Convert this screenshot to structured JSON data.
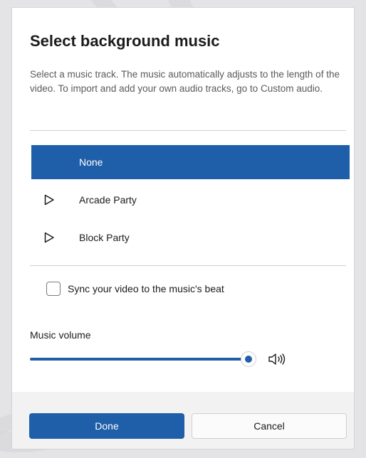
{
  "dialog": {
    "title": "Select background music",
    "description": "Select a music track. The music automatically adjusts to the length of the video. To import and add your own audio tracks, go to Custom audio."
  },
  "tracks": [
    {
      "label": "None",
      "selected": true,
      "has_play_icon": false
    },
    {
      "label": "Arcade Party",
      "selected": false,
      "has_play_icon": true,
      "icon": "play-outline-icon"
    },
    {
      "label": "Block Party",
      "selected": false,
      "has_play_icon": true,
      "icon": "play-outline-icon"
    }
  ],
  "sync": {
    "label": "Sync your video to the music's beat",
    "checked": false
  },
  "volume": {
    "label": "Music volume",
    "level_fraction": 0.97,
    "icon": "speaker-volume-icon"
  },
  "footer": {
    "done_label": "Done",
    "cancel_label": "Cancel"
  },
  "colors": {
    "accent": "#1f5ea8",
    "selected_text": "#ffffff",
    "footer_bg": "#f2f2f2"
  }
}
